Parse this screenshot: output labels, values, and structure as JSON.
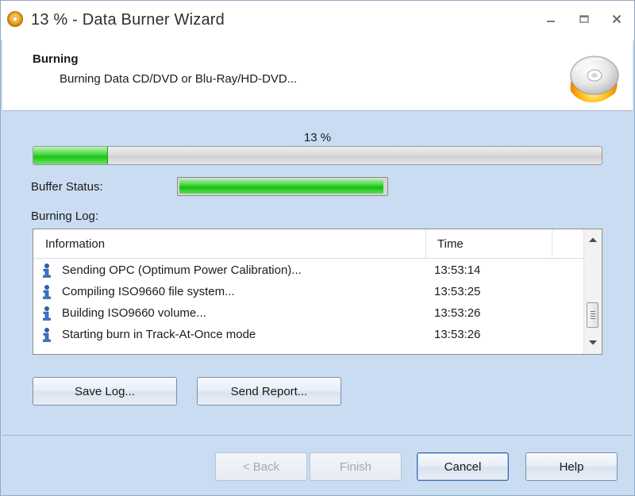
{
  "window": {
    "title": "13 % - Data Burner Wizard",
    "app_icon": "disc-app-icon"
  },
  "header": {
    "title": "Burning",
    "subtitle": "Burning Data CD/DVD or Blu-Ray/HD-DVD...",
    "icon": "burning-disc-icon"
  },
  "progress": {
    "label": "13 %",
    "value": 0.13
  },
  "buffer": {
    "label": "Buffer Status:",
    "value": 0.99
  },
  "log": {
    "label": "Burning Log:",
    "columns": {
      "info": "Information",
      "time": "Time"
    },
    "rows": [
      {
        "info": "Sending OPC (Optimum Power Calibration)...",
        "time": "13:53:14",
        "icon": "info-icon"
      },
      {
        "info": "Compiling ISO9660 file system...",
        "time": "13:53:25",
        "icon": "info-icon"
      },
      {
        "info": "Building ISO9660 volume...",
        "time": "13:53:26",
        "icon": "info-icon"
      },
      {
        "info": "Starting burn in Track-At-Once mode",
        "time": "13:53:26",
        "icon": "info-icon"
      }
    ]
  },
  "buttons": {
    "save_log": "Save Log...",
    "send_report": "Send Report...",
    "back": "< Back",
    "finish": "Finish",
    "cancel": "Cancel",
    "help": "Help"
  },
  "colors": {
    "window_bg": "#c9dcf1",
    "progress_green": "#17c612",
    "border_blue": "#3d6aa8"
  }
}
